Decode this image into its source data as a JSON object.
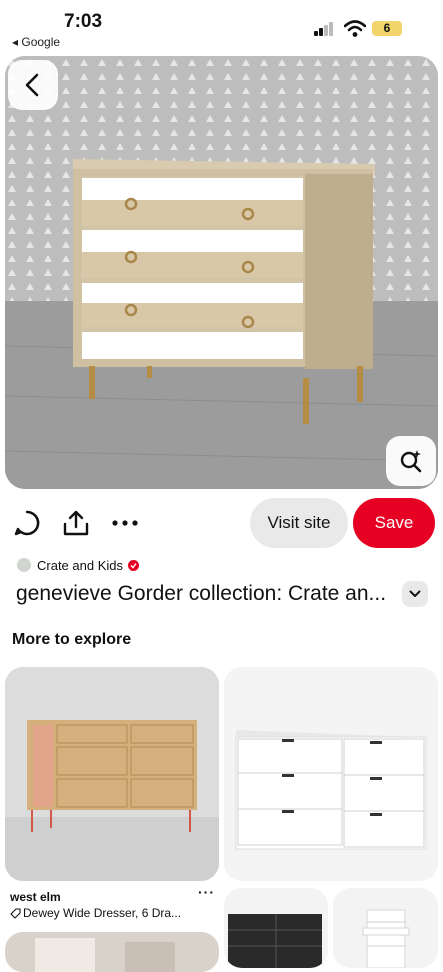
{
  "status_bar": {
    "time": "7:03",
    "back_app": "◂ Google",
    "battery": "6"
  },
  "hero": {
    "icon_back": "chevron-left-icon",
    "icon_lens": "visual-search-icon"
  },
  "actions": {
    "comment_icon": "comment-icon",
    "share_icon": "share-icon",
    "more_icon": "more-icon",
    "visit_label": "Visit site",
    "save_label": "Save"
  },
  "pin": {
    "creator": "Crate and Kids",
    "title": "genevieve Gorder collection: Crate an..."
  },
  "more_to_explore": {
    "heading": "More to explore",
    "cards": [
      {
        "brand": "west elm",
        "subtitle": "Dewey Wide Dresser, 6 Dra...",
        "more": "···"
      }
    ]
  },
  "colors": {
    "accent": "#e60023",
    "button_bg": "#e9e9e9"
  }
}
